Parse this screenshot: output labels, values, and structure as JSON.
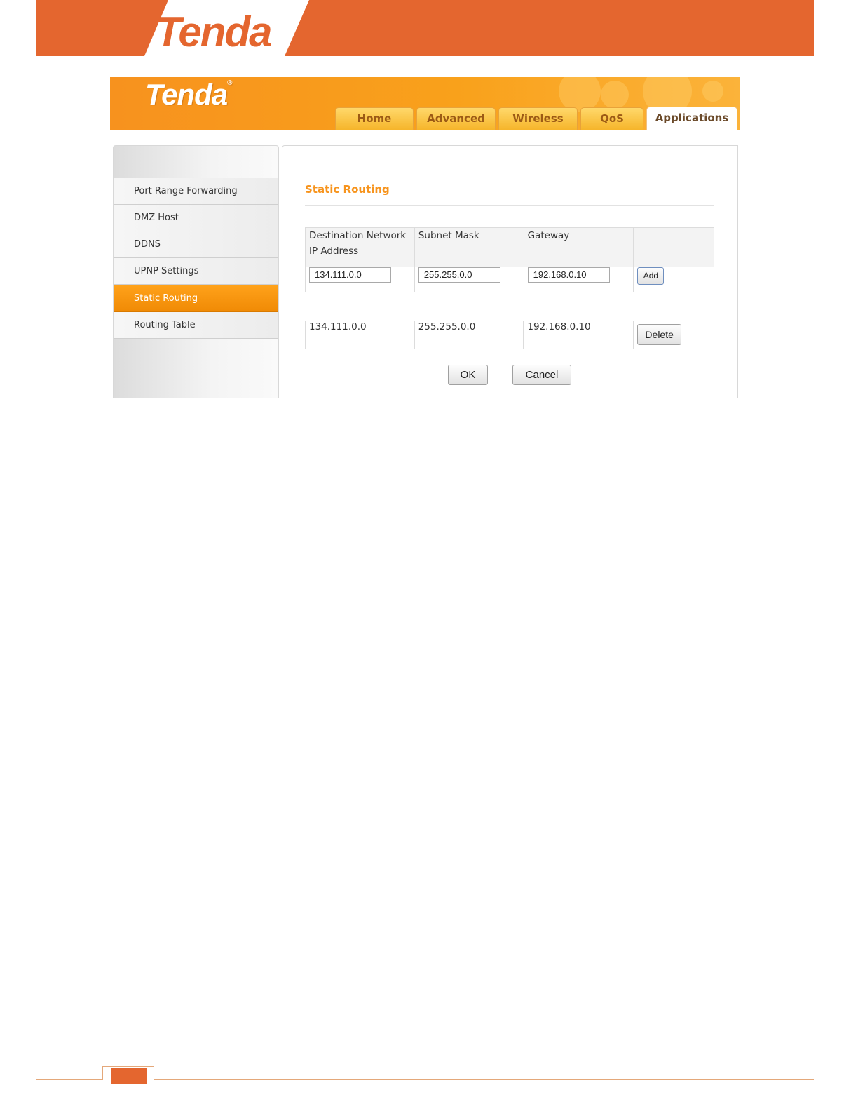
{
  "document": {
    "logo": "Tenda"
  },
  "router_ui": {
    "logo": "Tenda",
    "logo_mark": "®",
    "nav_tabs": [
      {
        "label": "Home",
        "active": false
      },
      {
        "label": "Advanced",
        "active": false
      },
      {
        "label": "Wireless",
        "active": false
      },
      {
        "label": "QoS",
        "active": false
      },
      {
        "label": "Applications",
        "active": true
      }
    ],
    "sidebar": {
      "items": [
        {
          "label": "Port Range Forwarding",
          "active": false
        },
        {
          "label": "DMZ Host",
          "active": false
        },
        {
          "label": "DDNS",
          "active": false
        },
        {
          "label": "UPNP Settings",
          "active": false
        },
        {
          "label": "Static Routing",
          "active": true
        },
        {
          "label": "Routing Table",
          "active": false
        }
      ]
    },
    "main": {
      "title": "Static Routing",
      "columns": {
        "dest_line1": "Destination Network",
        "dest_line2": "IP Address",
        "mask": "Subnet Mask",
        "gateway": "Gateway"
      },
      "inputs": {
        "dest": "134.111.0.0",
        "mask": "255.255.0.0",
        "gateway": "192.168.0.10"
      },
      "add_label": "Add",
      "routes": [
        {
          "dest": "134.111.0.0",
          "mask": "255.255.0.0",
          "gateway": "192.168.0.10",
          "action": "Delete"
        }
      ],
      "ok_label": "OK",
      "cancel_label": "Cancel"
    }
  },
  "colors": {
    "brand_orange": "#e4662f",
    "ui_orange": "#f7941d",
    "active_item": "#f59a10"
  }
}
